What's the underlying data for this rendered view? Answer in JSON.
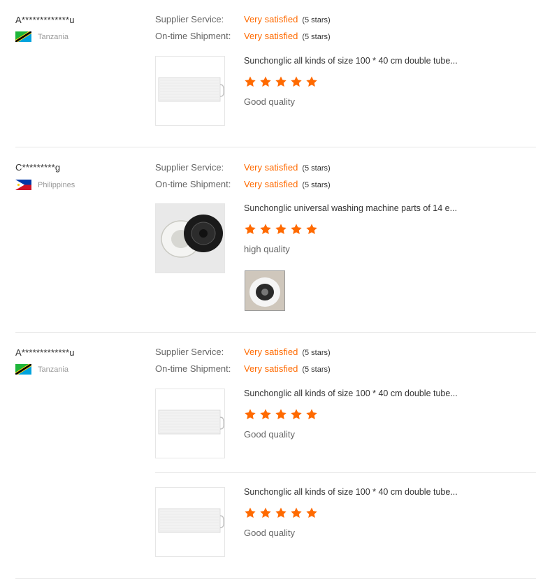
{
  "labels": {
    "supplier_service": "Supplier Service:",
    "ontime_shipment": "On-time Shipment:"
  },
  "colors": {
    "accent": "#ff6a00",
    "divider": "#e6e6e6"
  },
  "reviews": [
    {
      "buyer": "A*************u",
      "country": "Tanzania",
      "flag": "tanzania-flag",
      "supplier_service": {
        "value": "Very satisfied",
        "stars": "(5 stars)"
      },
      "ontime_shipment": {
        "value": "Very satisfied",
        "stars": "(5 stars)"
      },
      "products": [
        {
          "title": "Sunchonglic all kinds of size 100 * 40 cm double tube...",
          "rating": 5,
          "comment": "Good quality",
          "image": "white-panel"
        }
      ]
    },
    {
      "buyer": "C*********g",
      "country": "Philippines",
      "flag": "philippines-flag",
      "supplier_service": {
        "value": "Very satisfied",
        "stars": "(5 stars)"
      },
      "ontime_shipment": {
        "value": "Very satisfied",
        "stars": "(5 stars)"
      },
      "products": [
        {
          "title": "Sunchonglic universal washing machine parts of 14 e...",
          "rating": 5,
          "comment": "high quality",
          "image": "seal-rings",
          "attachment": "seal-photo"
        }
      ]
    },
    {
      "buyer": "A*************u",
      "country": "Tanzania",
      "flag": "tanzania-flag",
      "supplier_service": {
        "value": "Very satisfied",
        "stars": "(5 stars)"
      },
      "ontime_shipment": {
        "value": "Very satisfied",
        "stars": "(5 stars)"
      },
      "products": [
        {
          "title": "Sunchonglic all kinds of size 100 * 40 cm double tube...",
          "rating": 5,
          "comment": "Good quality",
          "image": "white-panel"
        },
        {
          "title": "Sunchonglic all kinds of size 100 * 40 cm double tube...",
          "rating": 5,
          "comment": "Good quality",
          "image": "white-panel"
        }
      ]
    }
  ]
}
